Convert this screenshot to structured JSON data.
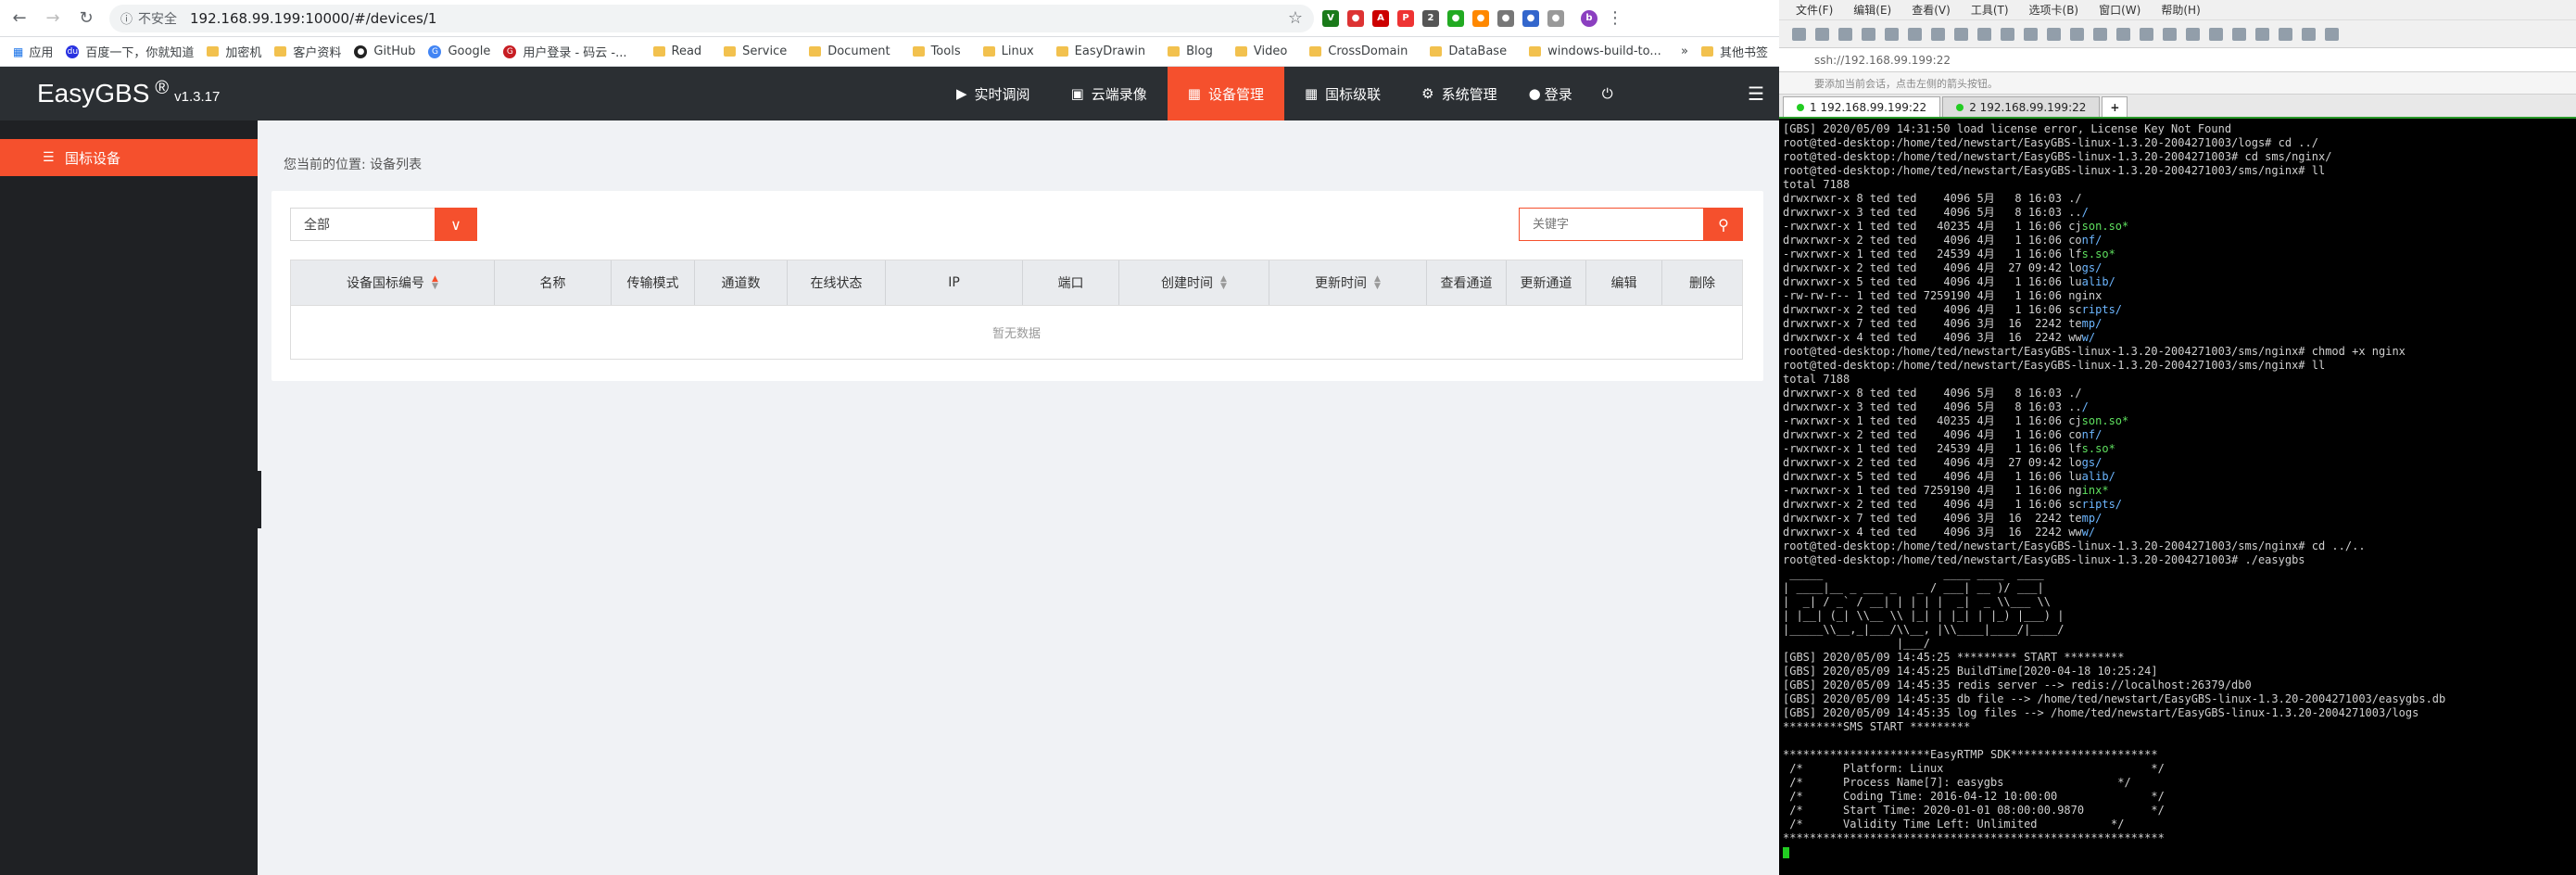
{
  "browser": {
    "insecure_label": "不安全",
    "url": "192.168.99.199:10000/#/devices/1",
    "bookmarks": [
      "应用",
      "百度一下，你就知道",
      "加密机",
      "客户资料",
      "GitHub",
      "Google",
      "用户登录 - 码云 -...",
      "Read",
      "Service",
      "Document",
      "Tools",
      "Linux",
      "EasyDrawin",
      "Blog",
      "Video",
      "CrossDomain",
      "DataBase",
      "windows-build-to...",
      "其他书签"
    ]
  },
  "app": {
    "logo": "EasyGBS",
    "registered": "®",
    "version": "v1.3.17",
    "menu": [
      {
        "label": "实时调阅",
        "icon": "play-icon"
      },
      {
        "label": "云端录像",
        "icon": "video-camera-icon"
      },
      {
        "label": "设备管理",
        "icon": "grid-icon",
        "active": true
      },
      {
        "label": "国标级联",
        "icon": "cascade-icon"
      },
      {
        "label": "系统管理",
        "icon": "gear-icon"
      },
      {
        "label": "登录",
        "icon": "user-icon"
      }
    ],
    "sidebar": {
      "items": [
        {
          "label": "国标设备",
          "icon": "list-icon"
        }
      ]
    },
    "breadcrumb": "您当前的位置:  设备列表",
    "filter": {
      "selected": "全部",
      "search_placeholder": "关键字"
    },
    "table": {
      "columns": [
        "设备国标编号",
        "名称",
        "传输模式",
        "通道数",
        "在线状态",
        "IP",
        "端口",
        "创建时间",
        "更新时间",
        "查看通道",
        "更新通道",
        "编辑",
        "删除"
      ],
      "empty_text": "暂无数据"
    }
  },
  "terminal": {
    "menu": [
      "文件(F)",
      "编辑(E)",
      "查看(V)",
      "工具(T)",
      "选项卡(B)",
      "窗口(W)",
      "帮助(H)"
    ],
    "address": "ssh://192.168.99.199:22",
    "hint": "要添加当前会话，点击左侧的箭头按钮。",
    "tabs": [
      "1 192.168.99.199:22",
      "2 192.168.99.199:22"
    ],
    "lines": [
      "[GBS] 2020/05/09 14:31:50 load license error, License Key Not Found",
      "root@ted-desktop:/home/ted/newstart/EasyGBS-linux-1.3.20-2004271003/logs# cd ../",
      "root@ted-desktop:/home/ted/newstart/EasyGBS-linux-1.3.20-2004271003# cd sms/nginx/",
      "root@ted-desktop:/home/ted/newstart/EasyGBS-linux-1.3.20-2004271003/sms/nginx# ll",
      "total 7188",
      "drwxrwxr-x 8 ted ted    4096 5月   8 16:03 ./",
      "drwxrwxr-x 3 ted ted    4096 5月   8 16:03 ../",
      "-rwxrwxr-x 1 ted ted   40235 4月   1 16:06 cjson.so*",
      "drwxrwxr-x 2 ted ted    4096 4月   1 16:06 conf/",
      "-rwxrwxr-x 1 ted ted   24539 4月   1 16:06 lfs.so*",
      "drwxrwxr-x 2 ted ted    4096 4月  27 09:42 logs/",
      "drwxrwxr-x 5 ted ted    4096 4月   1 16:06 lualib/",
      "-rw-rw-r-- 1 ted ted 7259190 4月   1 16:06 nginx",
      "drwxrwxr-x 2 ted ted    4096 4月   1 16:06 scripts/",
      "drwxrwxr-x 7 ted ted    4096 3月  16  2242 temp/",
      "drwxrwxr-x 4 ted ted    4096 3月  16  2242 www/",
      "root@ted-desktop:/home/ted/newstart/EasyGBS-linux-1.3.20-2004271003/sms/nginx# chmod +x nginx",
      "root@ted-desktop:/home/ted/newstart/EasyGBS-linux-1.3.20-2004271003/sms/nginx# ll",
      "total 7188",
      "drwxrwxr-x 8 ted ted    4096 5月   8 16:03 ./",
      "drwxrwxr-x 3 ted ted    4096 5月   8 16:03 ../",
      "-rwxrwxr-x 1 ted ted   40235 4月   1 16:06 cjson.so*",
      "drwxrwxr-x 2 ted ted    4096 4月   1 16:06 conf/",
      "-rwxrwxr-x 1 ted ted   24539 4月   1 16:06 lfs.so*",
      "drwxrwxr-x 2 ted ted    4096 4月  27 09:42 logs/",
      "drwxrwxr-x 5 ted ted    4096 4月   1 16:06 lualib/",
      "-rwxrwxr-x 1 ted ted 7259190 4月   1 16:06 nginx*",
      "drwxrwxr-x 2 ted ted    4096 4月   1 16:06 scripts/",
      "drwxrwxr-x 7 ted ted    4096 3月  16  2242 temp/",
      "drwxrwxr-x 4 ted ted    4096 3月  16  2242 www/",
      "root@ted-desktop:/home/ted/newstart/EasyGBS-linux-1.3.20-2004271003/sms/nginx# cd ../..",
      "root@ted-desktop:/home/ted/newstart/EasyGBS-linux-1.3.20-2004271003# ./easygbs",
      " _____                  ____ ____  ____  ",
      "| ____|__ _ ___ _   _ / ___| __ )/ ___| ",
      "|  _| / _` / __| | | | |  _|  _ \\\\___ \\\\ ",
      "| |__| (_| \\\\__ \\\\ |_| | |_| | |_) |___) |",
      "|_____\\\\__,_|___/\\\\__, |\\\\____|____/|____/ ",
      "                 |___/                    ",
      "[GBS] 2020/05/09 14:45:25 ********* START *********",
      "[GBS] 2020/05/09 14:45:25 BuildTime[2020-04-18 10:25:24]",
      "[GBS] 2020/05/09 14:45:35 redis server --> redis://localhost:26379/db0",
      "[GBS] 2020/05/09 14:45:35 db file --> /home/ted/newstart/EasyGBS-linux-1.3.20-2004271003/easygbs.db",
      "[GBS] 2020/05/09 14:45:35 log files --> /home/ted/newstart/EasyGBS-linux-1.3.20-2004271003/logs",
      "*********SMS START *********",
      "",
      "**********************EasyRTMP SDK**********************",
      " /*      Platform: Linux                               */",
      " /*      Process Name[7]: easygbs                 */",
      " /*      Coding Time: 2016-04-12 10:00:00              */",
      " /*      Start Time: 2020-01-01 08:00:00.9870          */",
      " /*      Validity Time Left: Unlimited           */",
      "*********************************************************"
    ]
  }
}
